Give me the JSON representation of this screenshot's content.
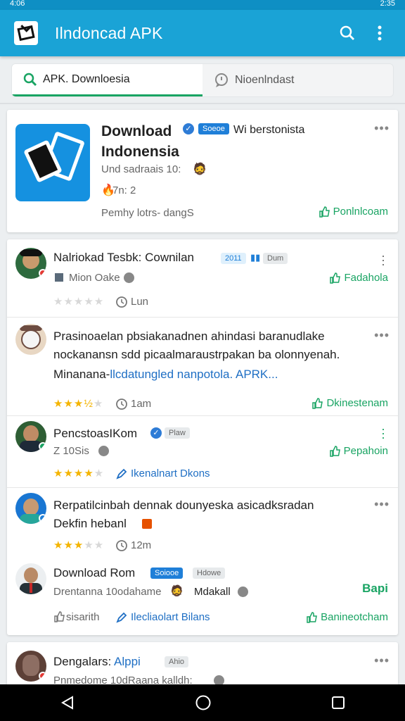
{
  "status": {
    "left": "4:06",
    "right": "2:35"
  },
  "appbar": {
    "title": "Ilndoncad APK",
    "logo_icon": "download-app-logo-icon",
    "search_icon": "search-icon",
    "menu_icon": "more-vert-icon"
  },
  "tabs": [
    {
      "label": "APK. Downloesia",
      "icon": "search-icon"
    },
    {
      "label": "Nioenlndast",
      "icon": "chat-icon"
    }
  ],
  "featured": {
    "title": "Download Indonensia",
    "badge": "Soeoe",
    "subtitle": "Wi berstonista",
    "meta1": "Und sadraais 10:",
    "meta2": "7n: 2",
    "footer": "Pemhy lotrs- dangS",
    "action": "Ponlnlcoam"
  },
  "items": [
    {
      "title": "Nalriokad Tesbk: Cownilan",
      "badge": "2011",
      "badge2": "Dum",
      "meta": "Mion Oake",
      "time": "Lun",
      "action": "Fadahola",
      "rating": 0
    },
    {
      "title": "Prasinoaelan pbsiakanadnen ahindasi baranudlake",
      "line2": "nockanansn sdd picaalmaraustrpakan ba olonnyenah.",
      "line3a": "Minanana-",
      "line3b": "llcdatungled nanpotola. APRK...",
      "time": "1am",
      "action": "Dkinestenam",
      "rating": 3.5
    },
    {
      "title": "PencstoasIKom",
      "badge": "Plaw",
      "meta": "Z 10Sis",
      "link": "Ikenalnart Dkons",
      "action": "Pepahoin",
      "rating": 4
    },
    {
      "title": "Rerpatilcinbah dennak dounyeska asicadksradan",
      "line2": "Dekfin hebanl",
      "time": "12m",
      "rating": 3
    },
    {
      "title": "Download Rom",
      "badge": "Soiooe",
      "badge2": "Hdowe",
      "meta": "Drentanna 10odahame",
      "meta_b": "Mdakall",
      "side": "Bapi",
      "bottom_left": "sisarith",
      "link": "Ilecliaolart Bilans",
      "action": "Banineotcham"
    },
    {
      "title": "Dengalars:",
      "title_b": "Alppi",
      "badge": "Ahio",
      "meta": "Pnmedome 10dRaana kalldh:"
    }
  ],
  "colors": {
    "appbar": "#1aa3d6",
    "accent": "#19a463",
    "link": "#1f6fc4",
    "badge": "#1f7fd8"
  },
  "nav": {
    "back_icon": "back-icon",
    "home_icon": "home-icon",
    "recents_icon": "recents-icon"
  }
}
